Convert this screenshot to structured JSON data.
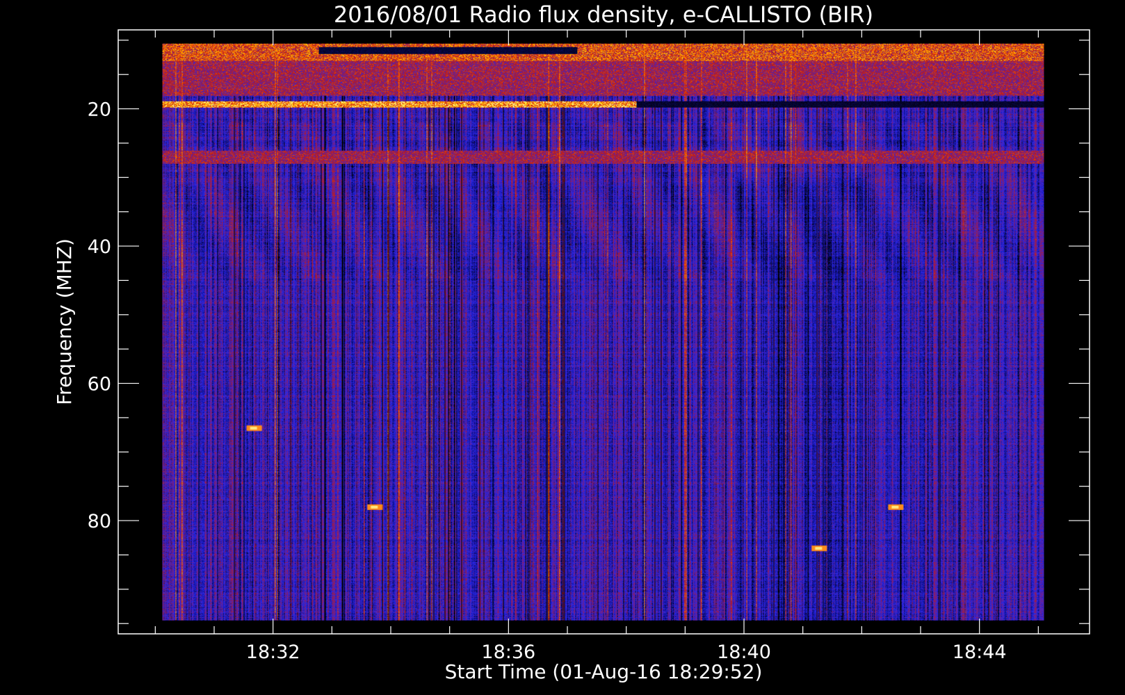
{
  "chart_data": {
    "type": "heatmap",
    "title": "2016/08/01  Radio flux density, e-CALLISTO (BIR)",
    "xlabel": "Start Time (01-Aug-16 18:29:52)",
    "ylabel": "Frequency (MHZ)",
    "x_ticks": [
      {
        "label": "18:32",
        "minutes": 2.13
      },
      {
        "label": "18:36",
        "minutes": 6.13
      },
      {
        "label": "18:40",
        "minutes": 10.13
      },
      {
        "label": "18:44",
        "minutes": 14.13
      }
    ],
    "y_ticks": [
      {
        "label": "20",
        "value": 20
      },
      {
        "label": "40",
        "value": 40
      },
      {
        "label": "60",
        "value": 60
      },
      {
        "label": "80",
        "value": 80
      }
    ],
    "xlim_minutes": [
      -0.5,
      16.0
    ],
    "ylim_mhz": [
      8.5,
      96.5
    ],
    "data_extent": {
      "minutes": [
        0.25,
        15.23
      ],
      "mhz": [
        10.5,
        94.5
      ]
    },
    "colormap": [
      "#000000",
      "#1010c0",
      "#3030ff",
      "#7a1e8a",
      "#c41a10",
      "#ff6a00",
      "#ffd000",
      "#ffffa0"
    ],
    "background_color": "#2828e8",
    "bright_bands": [
      {
        "mhz_start": 10.5,
        "mhz_end": 13.0,
        "minutes": [
          0.25,
          15.23
        ],
        "intensity": "high"
      },
      {
        "mhz_start": 13.0,
        "mhz_end": 18.0,
        "minutes": [
          0.25,
          15.23
        ],
        "intensity": "medium"
      },
      {
        "mhz_start": 18.8,
        "mhz_end": 19.8,
        "minutes": [
          0.25,
          8.3
        ],
        "intensity": "very-high"
      },
      {
        "mhz_start": 26.0,
        "mhz_end": 28.0,
        "minutes": [
          0.25,
          15.23
        ],
        "intensity": "medium"
      }
    ],
    "hot_spots": [
      {
        "minutes": 3.85,
        "mhz": 78.0
      },
      {
        "minutes": 12.7,
        "mhz": 78.0
      },
      {
        "minutes": 11.4,
        "mhz": 84.0
      },
      {
        "minutes": 1.8,
        "mhz": 66.5
      }
    ]
  }
}
